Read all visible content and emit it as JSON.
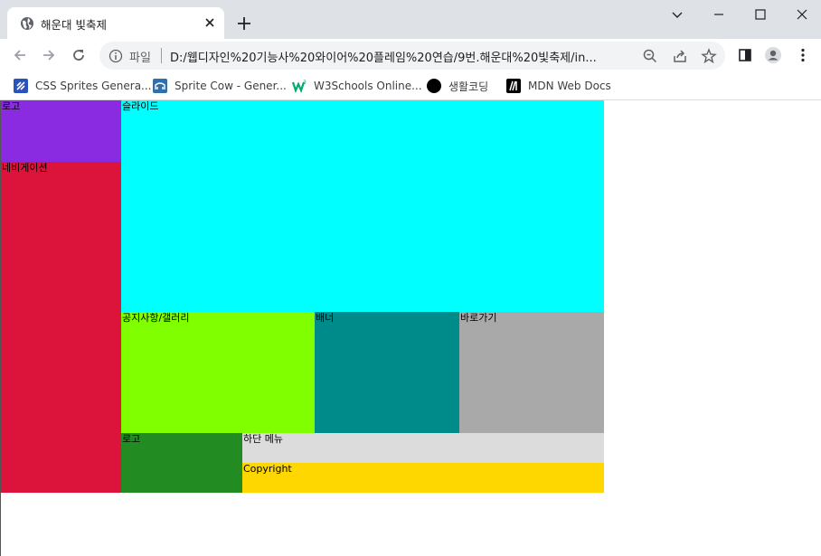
{
  "browser": {
    "tab_title": "해운대 빛축제",
    "address_scheme": "파일",
    "address_url": "D:/웹디자인%20기능사%20와이어%20플레임%20연습/9번.해운대%20빛축제/in...",
    "bookmarks": [
      {
        "label": "CSS Sprites Genera...",
        "icon": "css-sprites-icon"
      },
      {
        "label": "Sprite Cow - Gener...",
        "icon": "sprite-cow-icon"
      },
      {
        "label": "W3Schools Online...",
        "icon": "w3schools-icon"
      },
      {
        "label": "생활코딩",
        "icon": "saenghwal-coding-icon"
      },
      {
        "label": "MDN Web Docs",
        "icon": "mdn-icon"
      }
    ]
  },
  "page": {
    "logo": "로고",
    "navigation": "네비게이션",
    "slide": "슬라이드",
    "notice_gallery": "공지사항/갤러리",
    "banner": "배너",
    "shortcut": "바로가기",
    "footer_logo": "로고",
    "footer_menu": "하단 메뉴",
    "copyright": "Copyright"
  },
  "colors": {
    "logo": "#8a2be2",
    "navigation": "#dc143c",
    "slide": "#00ffff",
    "notice_gallery": "#7fff00",
    "banner": "#008b8b",
    "shortcut": "#a9a9a9",
    "footer_logo": "#228b22",
    "footer_menu": "#dcdcdc",
    "copyright": "#ffd700"
  }
}
